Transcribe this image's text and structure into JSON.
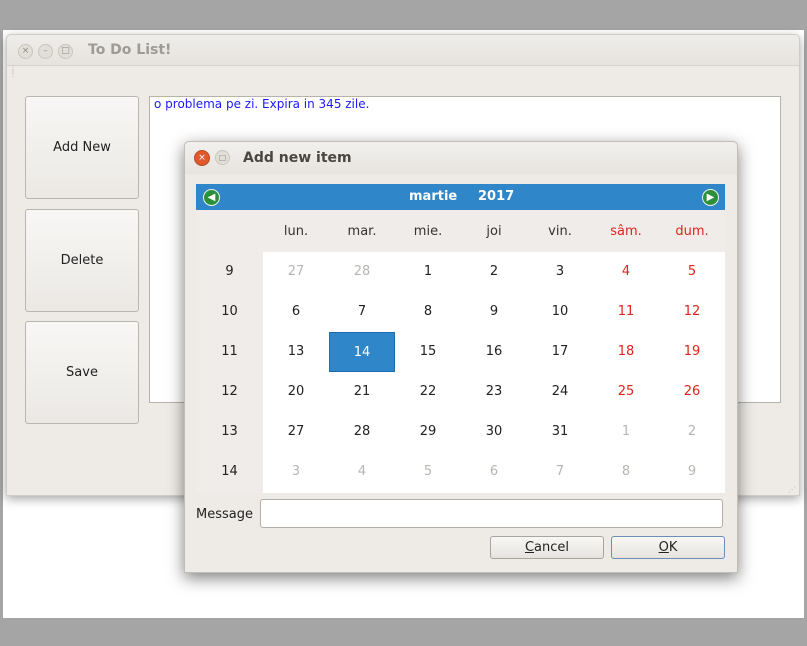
{
  "main_window": {
    "title": "To Do List!",
    "buttons": {
      "add_new": "Add New",
      "delete": "Delete",
      "save": "Save"
    },
    "list_items": [
      "o problema pe zi. Expira in 345 zile."
    ]
  },
  "dialog": {
    "title": "Add new item",
    "calendar": {
      "month": "martie",
      "year": "2017",
      "weekday_headers": [
        "lun.",
        "mar.",
        "mie.",
        "joi",
        "vin.",
        "sâm.",
        "dum."
      ],
      "weeks": [
        {
          "week": "9",
          "days": [
            "27",
            "28",
            "1",
            "2",
            "3",
            "4",
            "5"
          ]
        },
        {
          "week": "10",
          "days": [
            "6",
            "7",
            "8",
            "9",
            "10",
            "11",
            "12"
          ]
        },
        {
          "week": "11",
          "days": [
            "13",
            "14",
            "15",
            "16",
            "17",
            "18",
            "19"
          ]
        },
        {
          "week": "12",
          "days": [
            "20",
            "21",
            "22",
            "23",
            "24",
            "25",
            "26"
          ]
        },
        {
          "week": "13",
          "days": [
            "27",
            "28",
            "29",
            "30",
            "31",
            "1",
            "2"
          ]
        },
        {
          "week": "14",
          "days": [
            "3",
            "4",
            "5",
            "6",
            "7",
            "8",
            "9"
          ]
        }
      ],
      "selected_day": "14",
      "colors": {
        "header_bg": "#2f86c9",
        "weekend": "#e0241a",
        "other_month": "#b8b6b3"
      }
    },
    "message_label": "Message",
    "message_value": "",
    "cancel": {
      "mnemonic": "C",
      "rest": "ancel"
    },
    "ok": {
      "mnemonic": "O",
      "rest": "K"
    }
  }
}
